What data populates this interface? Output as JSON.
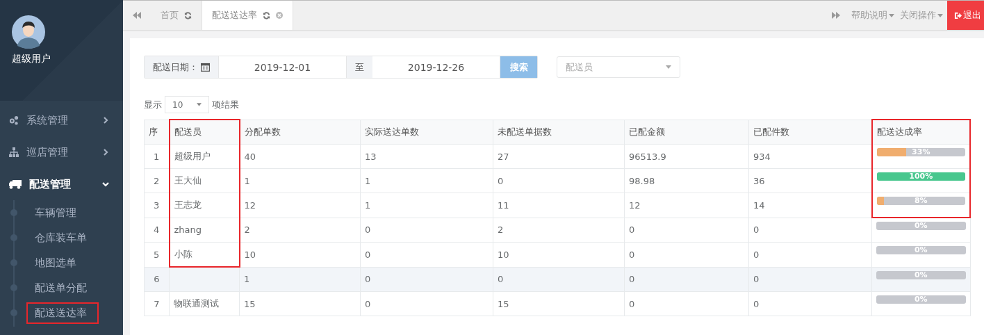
{
  "sidebar": {
    "user": {
      "name": "超级用户"
    },
    "items": [
      {
        "label": "系统管理",
        "kind": "gears",
        "expanded": false
      },
      {
        "label": "巡店管理",
        "kind": "sitemap",
        "expanded": false
      },
      {
        "label": "配送管理",
        "kind": "truck",
        "expanded": true,
        "children": [
          {
            "label": "车辆管理",
            "highlighted": false
          },
          {
            "label": "仓库装车单",
            "highlighted": false
          },
          {
            "label": "地图选单",
            "highlighted": false
          },
          {
            "label": "配送单分配",
            "highlighted": false
          },
          {
            "label": "配送送达率",
            "highlighted": true
          }
        ]
      }
    ]
  },
  "topbar": {
    "tabs": [
      {
        "label": "首页",
        "selected": false
      },
      {
        "label": "配送送达率",
        "selected": true
      }
    ],
    "menus": [
      "帮助说明",
      "关闭操作"
    ],
    "logout": "退出"
  },
  "filter": {
    "date_label": "配送日期：",
    "from": "2019-12-01",
    "to_label": "至",
    "to": "2019-12-26",
    "search": "搜索",
    "courier_placeholder": "配送员"
  },
  "page_length": {
    "prefix": "显示",
    "value": "10",
    "suffix": "项结果"
  },
  "table": {
    "columns": [
      {
        "label": "序",
        "highlighted": false
      },
      {
        "label": "配送员",
        "highlighted": true
      },
      {
        "label": "分配单数",
        "highlighted": false
      },
      {
        "label": "实际送达单数",
        "highlighted": false
      },
      {
        "label": "未配送单据数",
        "highlighted": false
      },
      {
        "label": "已配金额",
        "highlighted": false
      },
      {
        "label": "已配件数",
        "highlighted": false
      },
      {
        "label": "配送达成率",
        "highlighted": true
      }
    ],
    "rows": [
      {
        "cells": [
          "1",
          "超级用户",
          "40",
          "13",
          "27",
          "96513.9",
          "934"
        ],
        "rate": {
          "level": 0.33,
          "label": "33%",
          "color": "#f0ad6e"
        },
        "highlight": [
          false,
          true,
          false,
          false,
          false,
          false,
          false,
          true
        ],
        "hovered": false
      },
      {
        "cells": [
          "2",
          "王大仙",
          "1",
          "1",
          "0",
          "98.98",
          "36"
        ],
        "rate": {
          "level": 1,
          "label": "100%",
          "color": "#48c78e"
        },
        "highlight": [
          false,
          true,
          false,
          false,
          false,
          false,
          false,
          true
        ],
        "hovered": false
      },
      {
        "cells": [
          "3",
          "王志龙",
          "12",
          "1",
          "11",
          "12",
          "14"
        ],
        "rate": {
          "level": 0.08,
          "label": "8%",
          "color": "#f0ad6e"
        },
        "highlight": [
          false,
          true,
          false,
          false,
          false,
          false,
          false,
          true
        ],
        "hovered": false
      },
      {
        "cells": [
          "4",
          "zhang",
          "2",
          "0",
          "2",
          "0",
          "0"
        ],
        "rate": {
          "level": 0,
          "label": "0%"
        },
        "highlight": [
          false,
          true,
          false,
          false,
          false,
          false,
          false,
          false
        ],
        "hovered": false
      },
      {
        "cells": [
          "5",
          "小陈",
          "10",
          "0",
          "10",
          "0",
          "0"
        ],
        "rate": {
          "level": 0,
          "label": "0%"
        },
        "highlight": [
          false,
          true,
          false,
          false,
          false,
          false,
          false,
          false
        ],
        "hovered": false
      },
      {
        "cells": [
          "6",
          "",
          "1",
          "0",
          "0",
          "0",
          "0"
        ],
        "rate": {
          "level": 0,
          "label": "0%"
        },
        "highlight": [
          false,
          false,
          false,
          false,
          false,
          false,
          false,
          false
        ],
        "hovered": true
      },
      {
        "cells": [
          "7",
          "物联通测试",
          "15",
          "0",
          "15",
          "0",
          "0"
        ],
        "rate": {
          "level": 0,
          "label": "0%"
        },
        "highlight": [
          false,
          false,
          false,
          false,
          false,
          false,
          false,
          false
        ],
        "hovered": false
      }
    ]
  }
}
